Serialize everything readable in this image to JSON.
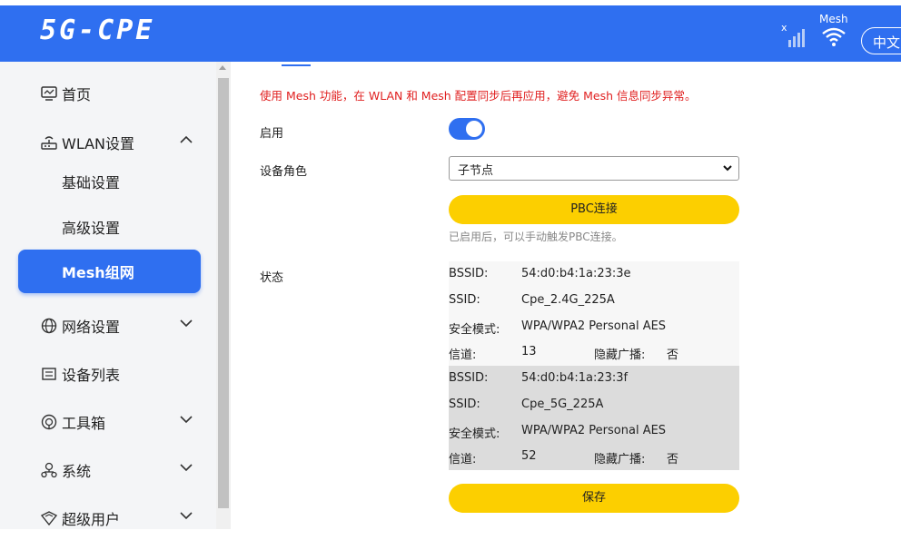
{
  "header": {
    "brand": "5G-CPE",
    "signal_x": "x",
    "mesh_label": "Mesh",
    "lang": "中文"
  },
  "sidebar": {
    "items": [
      {
        "label": "首页",
        "icon": "monitor-icon"
      },
      {
        "label": "WLAN设置",
        "icon": "router-icon",
        "expanded": true
      },
      {
        "label": "基础设置"
      },
      {
        "label": "高级设置"
      },
      {
        "label": "Mesh组网",
        "active": true
      },
      {
        "label": "网络设置",
        "icon": "globe-icon"
      },
      {
        "label": "设备列表",
        "icon": "list-icon"
      },
      {
        "label": "工具箱",
        "icon": "toolbox-icon"
      },
      {
        "label": "系统",
        "icon": "network-icon"
      },
      {
        "label": "超级用户",
        "icon": "shield-icon"
      }
    ]
  },
  "main": {
    "notice": "使用 Mesh 功能，在 WLAN 和 Mesh 配置同步后再应用，避免 Mesh 信息同步异常。",
    "enable_label": "启用",
    "role_label": "设备角色",
    "role_value": "子节点",
    "pbc_button": "PBC连接",
    "pbc_hint": "已启用后，可以手动触发PBC连接。",
    "status_label": "状态",
    "save_button": "保存",
    "status": [
      {
        "bssid_label": "BSSID:",
        "bssid": "54:d0:b4:1a:23:3e",
        "ssid_label": "SSID:",
        "ssid": "Cpe_2.4G_225A",
        "security_label": "安全模式:",
        "security": "WPA/WPA2 Personal AES",
        "channel_label": "信道:",
        "channel": "13",
        "hidden_label": "隐藏广播:",
        "hidden": "否"
      },
      {
        "bssid_label": "BSSID:",
        "bssid": "54:d0:b4:1a:23:3f",
        "ssid_label": "SSID:",
        "ssid": "Cpe_5G_225A",
        "security_label": "安全模式:",
        "security": "WPA/WPA2 Personal AES",
        "channel_label": "信道:",
        "channel": "52",
        "hidden_label": "隐藏广播:",
        "hidden": "否"
      }
    ]
  },
  "colors": {
    "accent": "#2f6ff0",
    "button": "#fccf00",
    "notice": "#e02020"
  }
}
